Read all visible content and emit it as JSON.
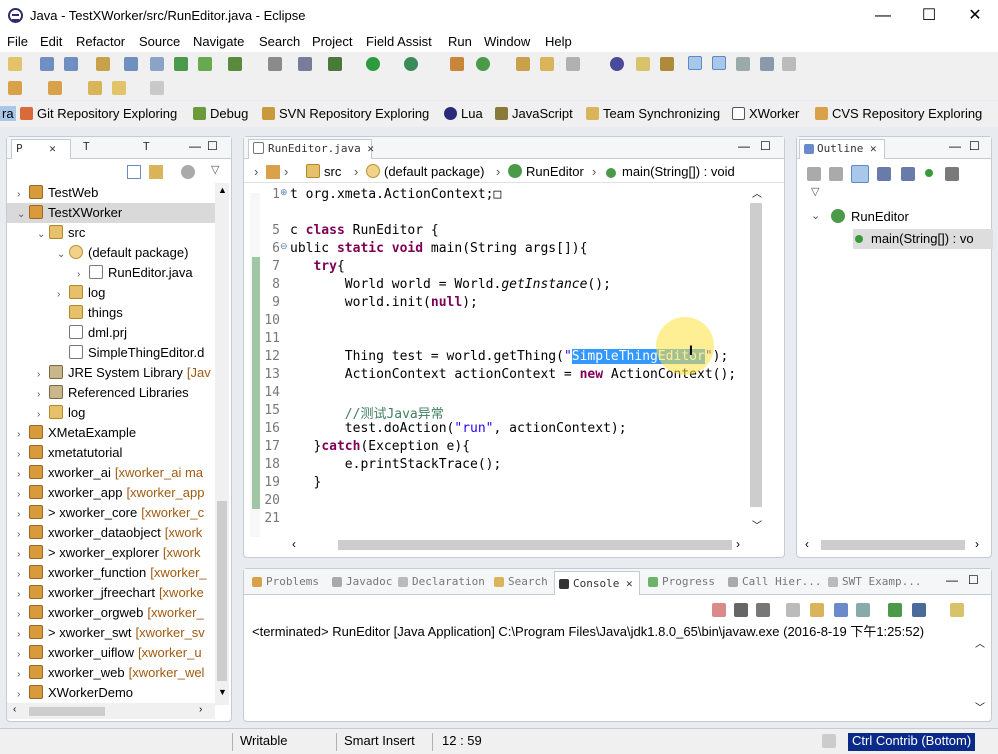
{
  "window": {
    "title": "Java - TestXWorker/src/RunEditor.java - Eclipse",
    "minimize": "—",
    "maximize": "☐",
    "close": "✕"
  },
  "menu": [
    "File",
    "Edit",
    "Refactor",
    "Source",
    "Navigate",
    "Search",
    "Project",
    "Field Assist",
    "Run",
    "Window",
    "Help"
  ],
  "perspectives": [
    "ra",
    "Git Repository Exploring",
    "Debug",
    "SVN Repository Exploring",
    "Lua",
    "JavaScript",
    "Team Synchronizing",
    "XWorker",
    "CVS Repository Exploring"
  ],
  "left_panel": {
    "tabs": [
      "P",
      "T",
      "T"
    ],
    "tree": [
      {
        "label": "TestWeb",
        "kind": "proj",
        "level": 0,
        "twisty": "›"
      },
      {
        "label": "TestXWorker",
        "kind": "proj",
        "level": 0,
        "twisty": "⌄",
        "selected": true
      },
      {
        "label": "src",
        "kind": "fold",
        "level": 1,
        "twisty": "⌄"
      },
      {
        "label": "(default package)",
        "kind": "pkg",
        "level": 2,
        "twisty": "⌄"
      },
      {
        "label": "RunEditor.java",
        "kind": "file",
        "level": 3,
        "twisty": "›"
      },
      {
        "label": "log",
        "kind": "fold",
        "level": 2,
        "twisty": "›"
      },
      {
        "label": "things",
        "kind": "fold",
        "level": 2,
        "twisty": ""
      },
      {
        "label": "dml.prj",
        "kind": "file",
        "level": 2,
        "twisty": ""
      },
      {
        "label": "SimpleThingEditor.d",
        "kind": "file",
        "level": 2,
        "twisty": ""
      },
      {
        "label": "JRE System Library",
        "deco": "[Jav",
        "kind": "lib",
        "level": 1,
        "twisty": "›"
      },
      {
        "label": "Referenced Libraries",
        "kind": "lib",
        "level": 1,
        "twisty": "›"
      },
      {
        "label": "log",
        "kind": "fold",
        "level": 1,
        "twisty": "›"
      },
      {
        "label": "XMetaExample",
        "kind": "proj",
        "level": 0,
        "twisty": "›"
      },
      {
        "label": "xmetatutorial",
        "kind": "proj",
        "level": 0,
        "twisty": "›"
      },
      {
        "label": "xworker_ai",
        "deco": "[xworker_ai ma",
        "kind": "proj",
        "level": 0,
        "twisty": "›"
      },
      {
        "label": "xworker_app",
        "deco": "[xworker_app",
        "kind": "proj",
        "level": 0,
        "twisty": "›"
      },
      {
        "label": "> xworker_core",
        "deco": "[xworker_c",
        "kind": "proj",
        "level": 0,
        "twisty": "›"
      },
      {
        "label": "xworker_dataobject",
        "deco": "[xwork",
        "kind": "proj",
        "level": 0,
        "twisty": "›"
      },
      {
        "label": "> xworker_explorer",
        "deco": "[xwork",
        "kind": "proj",
        "level": 0,
        "twisty": "›"
      },
      {
        "label": "xworker_function",
        "deco": "[xworker_",
        "kind": "proj",
        "level": 0,
        "twisty": "›"
      },
      {
        "label": "xworker_jfreechart",
        "deco": "[xworke",
        "kind": "proj",
        "level": 0,
        "twisty": "›"
      },
      {
        "label": "xworker_orgweb",
        "deco": "[xworker_",
        "kind": "proj",
        "level": 0,
        "twisty": "›"
      },
      {
        "label": "> xworker_swt",
        "deco": "[xworker_sv",
        "kind": "proj",
        "level": 0,
        "twisty": "›"
      },
      {
        "label": "xworker_uiflow",
        "deco": "[xworker_u",
        "kind": "proj",
        "level": 0,
        "twisty": "›"
      },
      {
        "label": "xworker_web",
        "deco": "[xworker_wel",
        "kind": "proj",
        "level": 0,
        "twisty": "›"
      },
      {
        "label": "XWorkerDemo",
        "kind": "proj",
        "level": 0,
        "twisty": "›"
      }
    ]
  },
  "editor": {
    "tab": "RunEditor.java",
    "breadcrumb": [
      "src",
      "(default package)",
      "RunEditor",
      "main(String[]) : void"
    ],
    "line_numbers": [
      "1",
      "5",
      "6",
      "7",
      "8",
      "9",
      "10",
      "11",
      "12",
      "13",
      "14",
      "15",
      "16",
      "17",
      "18",
      "19",
      "20",
      "21"
    ],
    "code": {
      "l1a": "t org.xmeta.ActionContext;",
      "l1b": "□",
      "l5a": "c ",
      "l5b": "class",
      "l5c": " RunEditor {",
      "l6a": "ublic ",
      "l6b": "static",
      "l6c": " ",
      "l6d": "void",
      "l6e": " main(String args[]){",
      "l7a": "   ",
      "l7b": "try",
      "l7c": "{",
      "l8a": "       World world = World.",
      "l8b": "getInstance",
      "l8c": "();",
      "l9a": "       world.init(",
      "l9b": "null",
      "l9c": ");",
      "l12a": "       Thing test = world.getThing(",
      "l12b": "\"",
      "l12c": "SimpleThingEditor",
      "l12d": "\"",
      "l12e": ");",
      "l13a": "       ActionContext actionContext = ",
      "l13b": "new",
      "l13c": " ActionContext();",
      "l15": "       //测试Java异常",
      "l16a": "       test.doAction(",
      "l16b": "\"run\"",
      "l16c": ", actionContext);",
      "l17a": "   }",
      "l17b": "catch",
      "l17c": "(Exception e){",
      "l18": "       e.printStackTrace();",
      "l19": "   }"
    }
  },
  "outline": {
    "tab": "Outline",
    "class": "RunEditor",
    "method": "main(String[]) : vo"
  },
  "bottom": {
    "tabs": [
      "Problems",
      "Javadoc",
      "Declaration",
      "Search",
      "Console",
      "Progress",
      "Call Hier...",
      "SWT Examp..."
    ],
    "console_line": "<terminated> RunEditor [Java Application] C:\\Program Files\\Java\\jdk1.8.0_65\\bin\\javaw.exe (2016-8-19 下午1:25:52)"
  },
  "status": {
    "writable": "Writable",
    "insert": "Smart Insert",
    "position": "12 : 59",
    "keys": "Ctrl Contrib (Bottom)"
  }
}
